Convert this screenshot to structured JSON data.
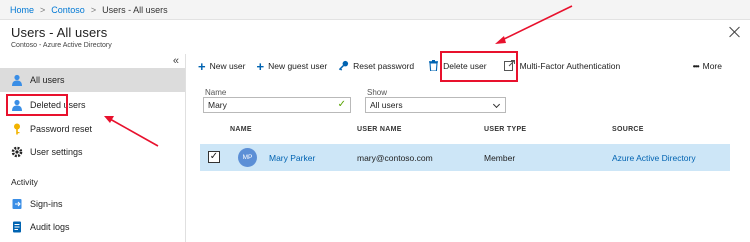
{
  "breadcrumb": {
    "home": "Home",
    "contoso": "Contoso",
    "current": "Users - All users"
  },
  "blade": {
    "title": "Users - All users",
    "subtitle": "Contoso - Azure Active Directory",
    "collapse_glyph": "«"
  },
  "sidebar": {
    "items": [
      {
        "label": "All users",
        "icon": "user-icon"
      },
      {
        "label": "Deleted users",
        "icon": "deleted-user-icon"
      },
      {
        "label": "Password reset",
        "icon": "key-icon"
      },
      {
        "label": "User settings",
        "icon": "gear-icon"
      }
    ],
    "activity_heading": "Activity",
    "activity_items": [
      {
        "label": "Sign-ins",
        "icon": "sign-in-icon"
      },
      {
        "label": "Audit logs",
        "icon": "audit-log-icon"
      }
    ]
  },
  "toolbar": {
    "new_user": "New user",
    "new_guest_user": "New guest user",
    "reset_password": "Reset password",
    "delete_user": "Delete user",
    "mfa": "Multi-Factor Authentication",
    "more": "More"
  },
  "filters": {
    "name_label": "Name",
    "name_value": "Mary",
    "show_label": "Show",
    "show_value": "All users"
  },
  "table": {
    "headers": [
      "NAME",
      "USER NAME",
      "USER TYPE",
      "SOURCE"
    ],
    "rows": [
      {
        "initials": "MP",
        "name": "Mary Parker",
        "user_name": "mary@contoso.com",
        "user_type": "Member",
        "source": "Azure Active Directory"
      }
    ]
  },
  "colors": {
    "accent": "#0078d4",
    "highlight": "#e8112d",
    "selected_row": "#cde6f7",
    "active_nav": "#dcdcdc"
  }
}
